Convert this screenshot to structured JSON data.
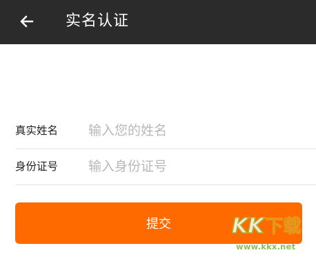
{
  "header": {
    "back_icon": "arrow-left-icon",
    "title": "实名认证",
    "background": "#2b2b2b"
  },
  "form": {
    "name_label": "真实姓名",
    "name_placeholder": "输入您的姓名",
    "name_value": "",
    "id_label": "身份证号",
    "id_placeholder": "输入身份证号",
    "id_value": ""
  },
  "submit": {
    "label": "提交",
    "color": "#ff6a00"
  },
  "watermark": {
    "brand": "KK下载",
    "url": "www.kkx.net"
  }
}
